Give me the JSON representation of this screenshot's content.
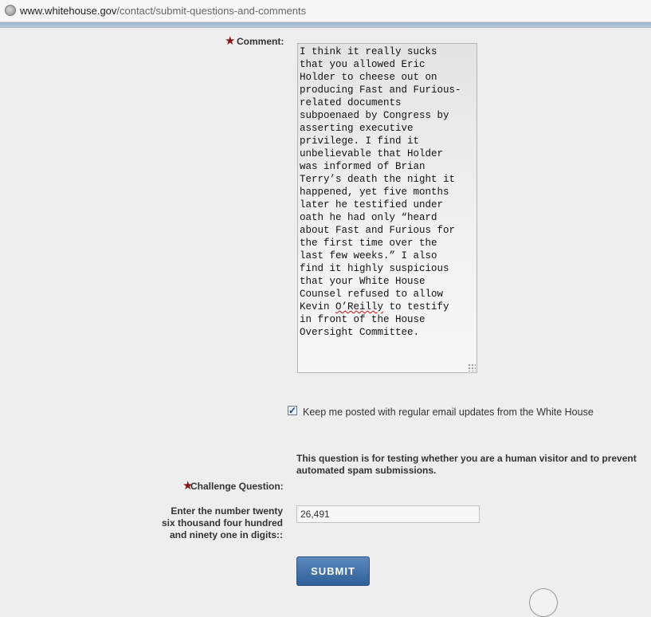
{
  "browser": {
    "url_host": "www.whitehouse.gov",
    "url_path": "/contact/submit-questions-and-comments",
    "globe_icon": "globe-icon"
  },
  "form": {
    "required_marker": "★",
    "comment_label": "Comment:",
    "comment_lines": [
      "I think it really sucks",
      "that you allowed Eric",
      "Holder to cheese out on",
      "producing Fast and Furious-",
      "related documents",
      "subpoenaed by Congress by",
      "asserting executive",
      "privilege. I find it",
      "unbelievable that Holder",
      "was informed of Brian",
      "Terry’s death the night it",
      "happened, yet five months",
      "later he testified under",
      "oath he had only “heard",
      "about Fast and Furious for",
      "the first time over the",
      "last few weeks.” I also",
      "find it highly suspicious",
      "that your White House",
      "Counsel refused to allow",
      "Kevin O’Reilly to testify",
      "in front of the House",
      "Oversight Committee."
    ],
    "keep_posted_checked": true,
    "check_mark": "✓",
    "keep_posted_label": "Keep me posted with regular email updates from the White House",
    "challenge_note": "This question is for testing whether you are a human visitor and to prevent automated spam submissions.",
    "challenge_label": "Challenge Question:",
    "challenge_prompt": "Enter the number twenty six thousand four hundred and ninety one in digits::",
    "challenge_answer": "26,491",
    "submit_label": "SUBMIT"
  }
}
